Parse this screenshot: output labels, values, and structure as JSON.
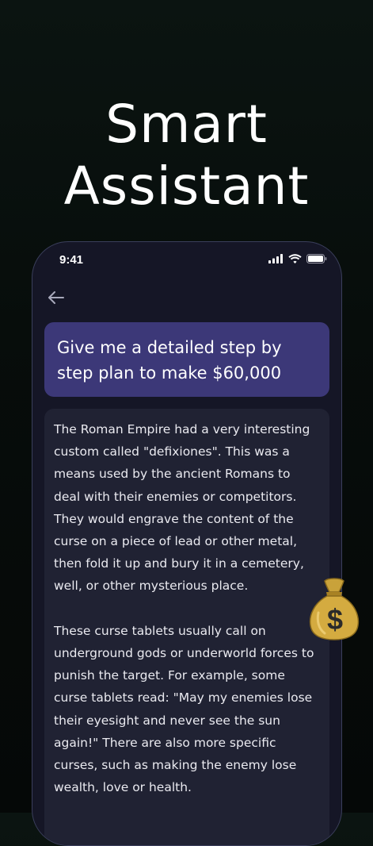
{
  "headline": {
    "line1": "Smart",
    "line2": "Assistant"
  },
  "status_bar": {
    "time": "9:41"
  },
  "chat": {
    "prompt": "Give me a detailed step by step plan to make $60,000",
    "response_paragraphs": [
      "The Roman Empire had a very interesting custom called \"defixiones\". This was a means used by the ancient Romans to deal with their enemies or competitors. They would engrave the content of the curse on a piece of lead or other metal, then fold it up and bury it in a cemetery, well, or other mysterious place.",
      "These curse tablets usually call on underground gods or underworld forces to punish the target. For example, some curse tablets read: \"May my enemies lose their eyesight and never see the sun again!\" There are also more specific curses, such as making the enemy lose wealth, love or health."
    ]
  },
  "decoration": {
    "sticker_icon": "money-bag-icon",
    "sticker_symbol": "$"
  },
  "colors": {
    "background": "#070d0b",
    "phone_background": "#151626",
    "prompt_bubble": "#3c3878",
    "answer_card": "#202233",
    "money_bag": "#c9a23a"
  }
}
